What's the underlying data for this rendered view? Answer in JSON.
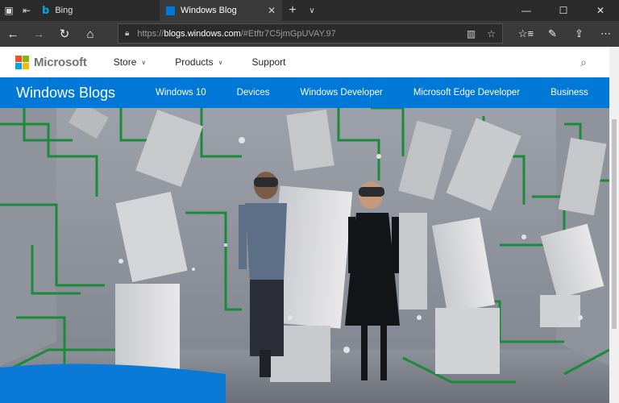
{
  "browser": {
    "tabs": [
      {
        "label": "Bing",
        "icon": "bing-icon",
        "active": false
      },
      {
        "label": "Windows Blog",
        "icon": "windows-icon",
        "active": true
      }
    ],
    "address": {
      "protocol": "https://",
      "host": "blogs.windows.com",
      "rest": "/#Etftr7C5jmGpUVAY.97"
    }
  },
  "ms_header": {
    "brand": "Microsoft",
    "nav": [
      {
        "label": "Store",
        "has_dropdown": true
      },
      {
        "label": "Products",
        "has_dropdown": true
      },
      {
        "label": "Support",
        "has_dropdown": false
      }
    ]
  },
  "blog_nav": {
    "title": "Windows Blogs",
    "links": [
      "Windows 10",
      "Devices",
      "Windows Developer",
      "Microsoft Edge Developer",
      "Business"
    ]
  },
  "colors": {
    "accent": "#0078d7",
    "chrome_dark": "#2b2b2b",
    "chrome_mid": "#3a3a3a"
  }
}
